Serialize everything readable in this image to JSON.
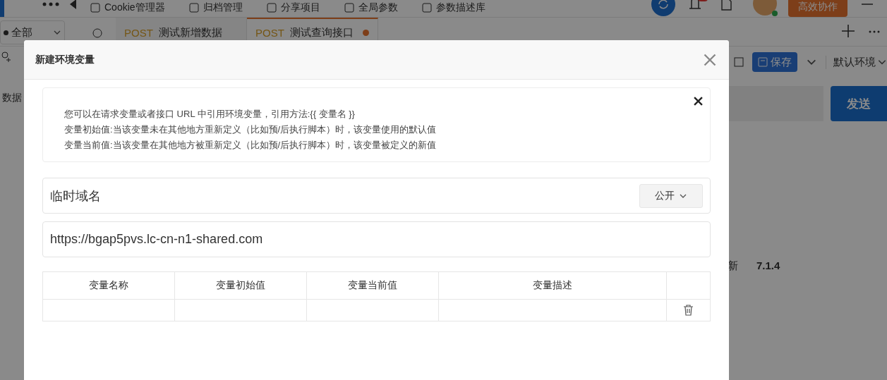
{
  "toolbar": {
    "items": [
      {
        "label": "Cookie管理器"
      },
      {
        "label": "归档管理"
      },
      {
        "label": "分享项目"
      },
      {
        "label": "全局参数"
      },
      {
        "label": "参数描述库"
      }
    ],
    "collab_button": "高效协作"
  },
  "scope_select": {
    "value": "全部"
  },
  "tabs": [
    {
      "method": "POST",
      "title": "测试新增数据",
      "selected": false,
      "unsaved": false
    },
    {
      "method": "POST",
      "title": "测试查询接口",
      "selected": true,
      "unsaved": true
    }
  ],
  "sidebar": {
    "items": [
      {
        "label": "数据"
      }
    ]
  },
  "request_bar": {
    "save": "保存",
    "environment": "默认环境",
    "send": "发送"
  },
  "version_row": {
    "label": "新",
    "value": "7.1.4"
  },
  "dialog": {
    "title": "新建环境变量",
    "info": [
      "您可以在请求变量或者接口 URL 中引用环境变量，引用方法:{{ 变量名 }}",
      "变量初始值:当该变量未在其他地方重新定义（比如预/后执行脚本）时，该变量使用的默认值",
      "变量当前值:当该变量在其他地方被重新定义（比如预/后执行脚本）时，该变量被定义的新值"
    ],
    "name": {
      "value": "临时域名"
    },
    "visibility": "公开",
    "url": {
      "value": "https://bgap5pvs.lc-cn-n1-shared.com"
    },
    "table": {
      "columns": [
        "变量名称",
        "变量初始值",
        "变量当前值",
        "变量描述"
      ],
      "rows": [
        {
          "deletable": true
        }
      ]
    }
  }
}
